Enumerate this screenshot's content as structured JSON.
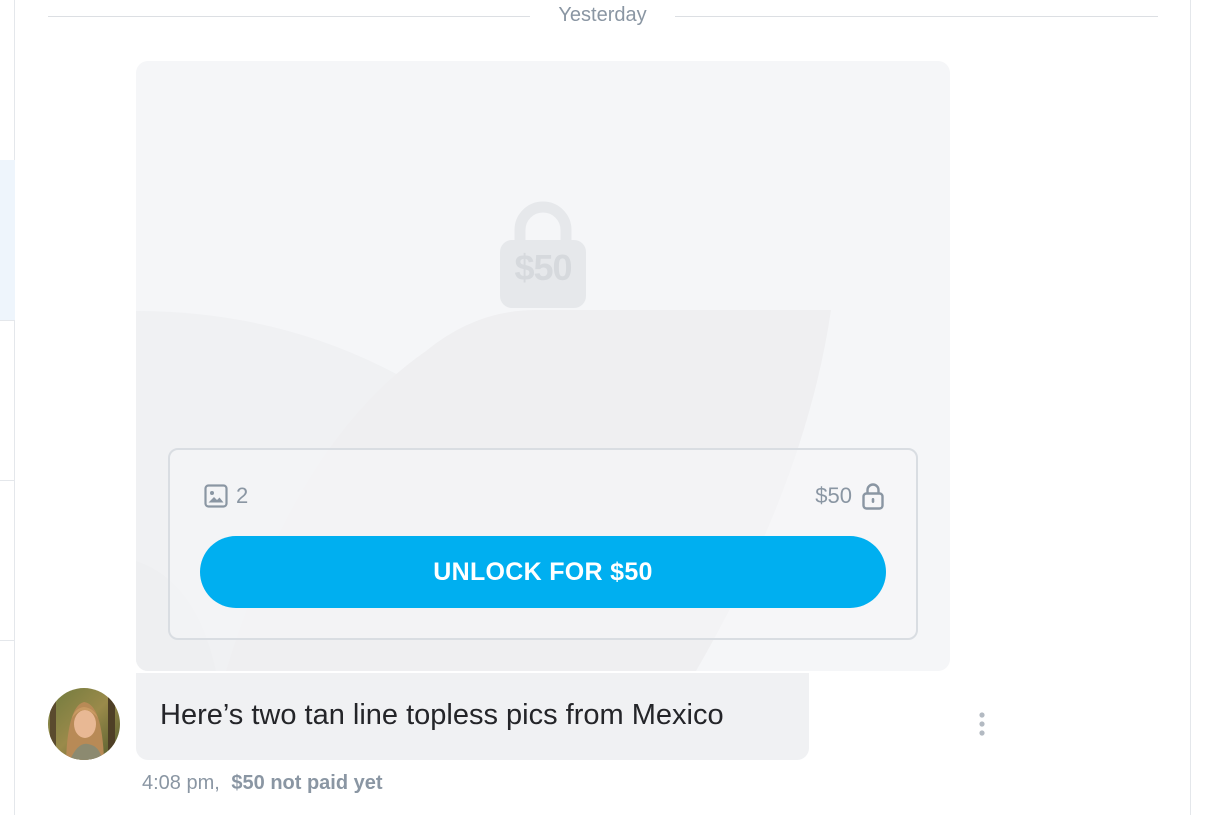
{
  "divider": {
    "label": "Yesterday"
  },
  "media": {
    "lock_overlay_price": "$50",
    "media_count": "2",
    "price": "$50",
    "unlock_label": "UNLOCK FOR $50",
    "media_type_icon": "image-icon",
    "lock_icon": "lock-icon"
  },
  "message": {
    "text": "Here’s two tan line topless pics from Mexico",
    "time": "4:08 pm,",
    "payment_status": "$50 not paid yet",
    "more_icon": "more-vertical-icon"
  },
  "colors": {
    "accent": "#00aff0",
    "muted_text": "#8a96a3",
    "card_bg": "#f5f6f8",
    "bubble_bg": "#f0f1f3"
  }
}
